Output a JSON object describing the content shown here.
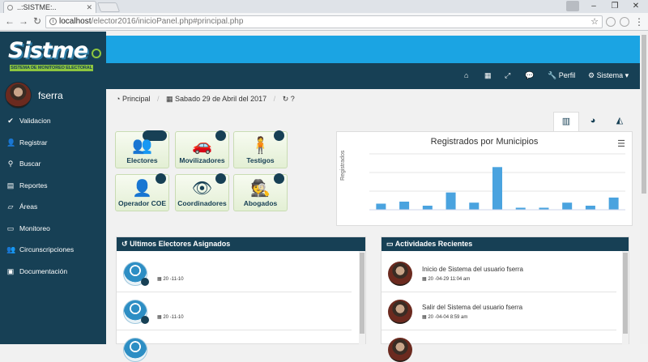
{
  "browser": {
    "tab_title": "..:SISTME:..",
    "url_host": "localhost",
    "url_path": "/elector2016/inicioPanel.php#principal.php"
  },
  "app": {
    "logo_text": "Sistme",
    "logo_subtitle": "SISTEMA DE MONITOREO ELECTORAL",
    "user": "fserra",
    "sidebar": [
      {
        "icon": "check-icon",
        "label": "Validacion"
      },
      {
        "icon": "user-icon",
        "label": "Registrar"
      },
      {
        "icon": "search-icon",
        "label": "Buscar"
      },
      {
        "icon": "file-icon",
        "label": "Reportes"
      },
      {
        "icon": "folder-icon",
        "label": "Áreas"
      },
      {
        "icon": "laptop-icon",
        "label": "Monitoreo"
      },
      {
        "icon": "users-icon",
        "label": "Circunscripciones"
      },
      {
        "icon": "doc-icon",
        "label": "Documentación"
      }
    ],
    "topnav": {
      "perfil": "Perfil",
      "sistema": "Sistema"
    },
    "breadcrumb": {
      "home": "Principal",
      "date": "Sabado 29 de Abril del 2017"
    },
    "tiles": [
      {
        "label": "Electores"
      },
      {
        "label": "Movilizadores"
      },
      {
        "label": "Testigos"
      },
      {
        "label": "Operador COE"
      },
      {
        "label": "Coordinadores"
      },
      {
        "label": "Abogados"
      }
    ],
    "recent_electors": {
      "title": "Ultimos Electores Asignados",
      "rows": [
        {
          "meta": "20   -11-10"
        },
        {
          "meta": "20   -11-10"
        }
      ]
    },
    "recent_activity": {
      "title": "Actividades Recientes",
      "rows": [
        {
          "title": "Inicio de Sistema del usuario fserra",
          "meta": "20   -04-29  11:04 am"
        },
        {
          "title": "Salir del Sistema del usuario fserra",
          "meta": "20   -04-04  8:59 am"
        }
      ]
    }
  },
  "chart_data": {
    "type": "bar",
    "title": "Registrados por Municipios",
    "ylabel": "Registrados",
    "categories": [
      "",
      "",
      "",
      "",
      "",
      "",
      "",
      "",
      "",
      "",
      ""
    ],
    "values": [
      6,
      8,
      4,
      17,
      7,
      42,
      2,
      2,
      7,
      4,
      12
    ],
    "ylim": [
      0,
      55
    ],
    "grid": true
  }
}
